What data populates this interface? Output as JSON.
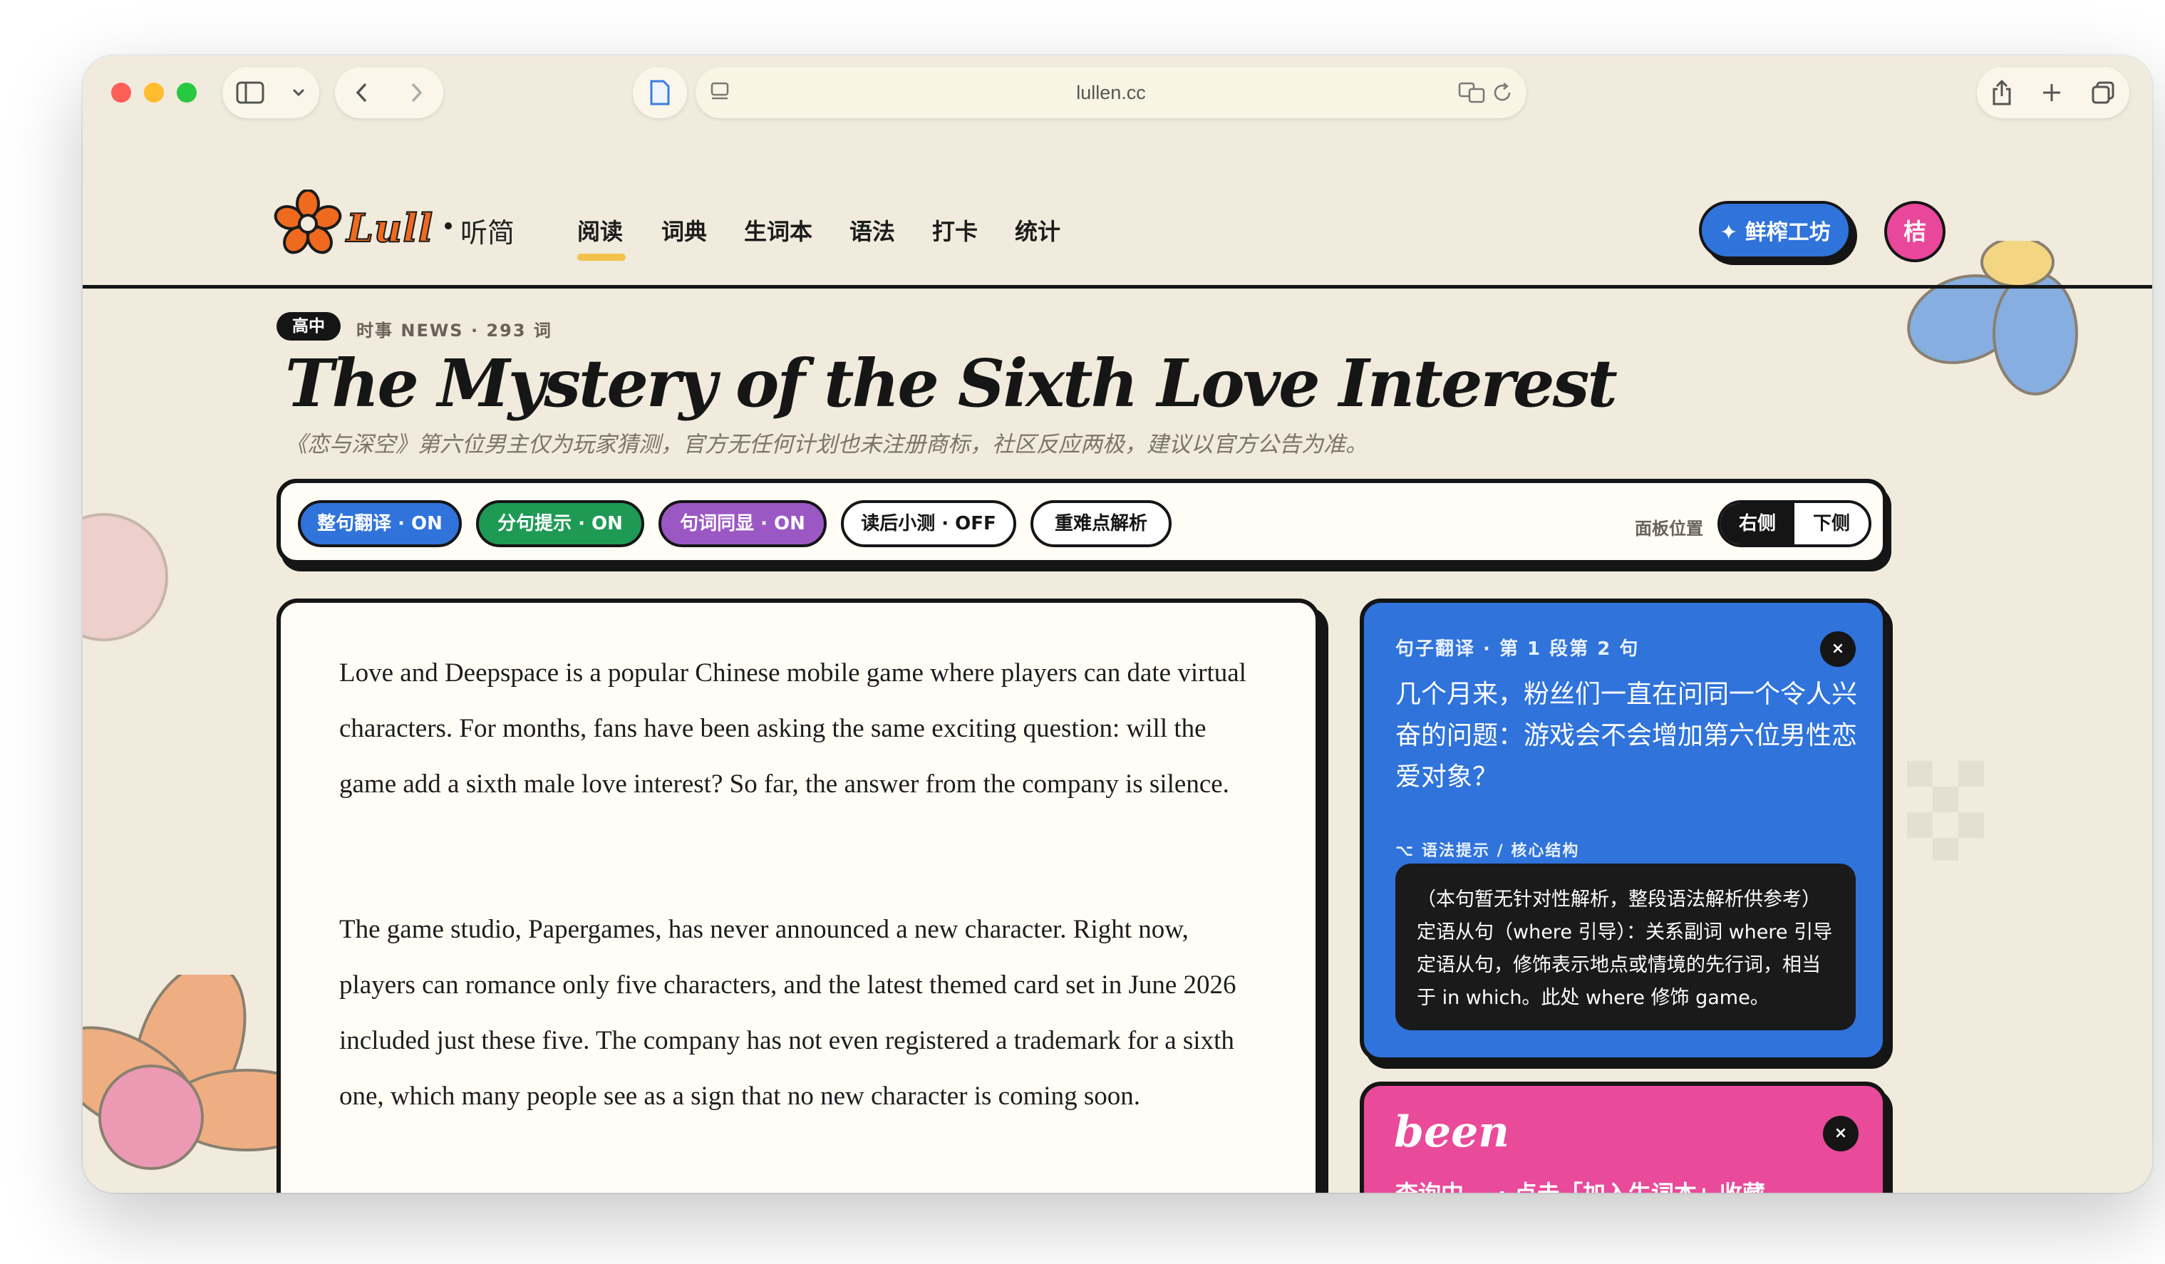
{
  "browser": {
    "url": "lullen.cc"
  },
  "nav": {
    "brand": "Lull",
    "brand_cn": "听简",
    "items": [
      "阅读",
      "词典",
      "生词本",
      "语法",
      "打卡",
      "统计"
    ],
    "cta": "✦ 鲜榨工坊",
    "avatar": "桔"
  },
  "article": {
    "level": "高中",
    "meta": "时事 NEWS · 293 词",
    "title": "The Mystery of the Sixth Love Interest",
    "subtitle": "《恋与深空》第六位男主仅为玩家猜测，官方无任何计划也未注册商标，社区反应两极，建议以官方公告为准。",
    "paragraphs": [
      "Love and Deepspace is a popular Chinese mobile game where players can date virtual characters. For months, fans have been asking the same exciting question: will the game add a sixth male love interest? So far, the answer from the company is silence.",
      "The game studio, Papergames, has never announced a new character. Right now, players can romance only five characters, and the latest themed card set in June 2026 included just these five. The company has not even registered a trademark for a sixth one, which many people see as a sign that no new character is coming soon."
    ]
  },
  "toolbar": {
    "chips": [
      {
        "label": "整句翻译 · ON",
        "state": "on",
        "color": "#2f73db"
      },
      {
        "label": "分句提示 · ON",
        "state": "on",
        "color": "#1e9a55"
      },
      {
        "label": "句词同显 · ON",
        "state": "on",
        "color": "#9b58c4"
      },
      {
        "label": "读后小测 · OFF",
        "state": "off",
        "color": "#ffffff"
      },
      {
        "label": "重难点解析",
        "state": "neutral",
        "color": "#ffffff"
      }
    ],
    "panel_label": "面板位置",
    "panel_options": [
      "右侧",
      "下侧"
    ],
    "panel_selected": "右侧"
  },
  "translation_card": {
    "header": "句子翻译 · 第 1 段第 2 句",
    "text": "几个月来，粉丝们一直在问同一个令人兴奋的问题：游戏会不会增加第六位男性恋爱对象？",
    "hint_header": "⌥ 语法提示 / 核心结构",
    "hint_text": "（本句暂无针对性解析，整段语法解析供参考）定语从句（where 引导）：关系副词 where 引导定语从句，修饰表示地点或情境的先行词，相当于 in which。此处 where 修饰 game。",
    "close": "×"
  },
  "word_card": {
    "word": "been",
    "status": "查询中... · 点击「加入生词本」收藏",
    "close": "×"
  },
  "colors": {
    "background": "#f1ebdd",
    "accent_blue": "#2f73db",
    "accent_pink": "#e94a9a",
    "accent_orange": "#ef6a1f",
    "ink": "#151515"
  }
}
